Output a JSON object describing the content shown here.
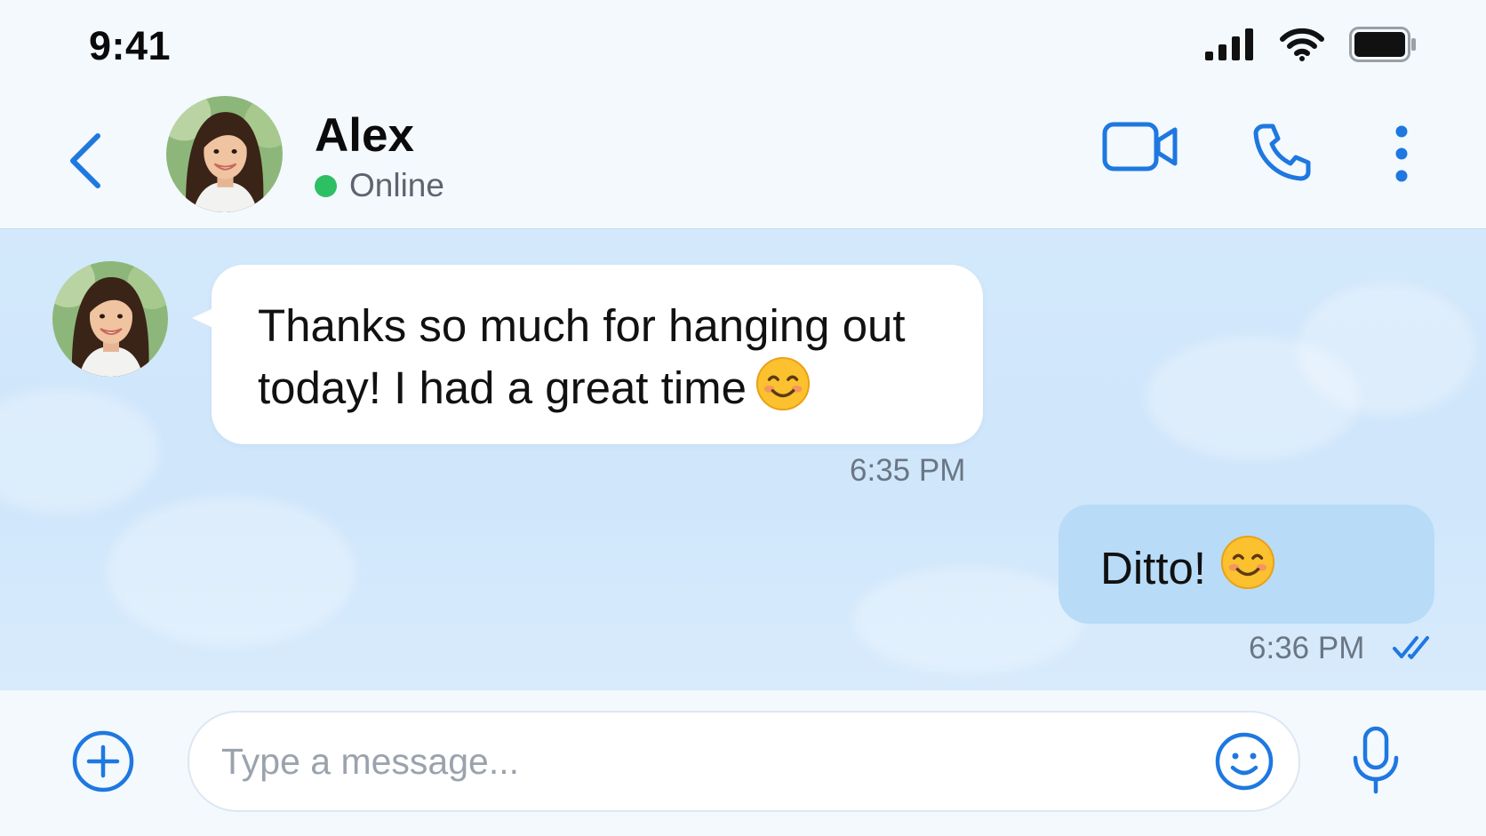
{
  "status_bar": {
    "time": "9:41",
    "icons": [
      "cellular-signal-icon",
      "wifi-icon",
      "battery-icon"
    ]
  },
  "header": {
    "back_icon": "chevron-left-icon",
    "contact_name": "Alex",
    "presence": "Online",
    "presence_color": "#2dbf63",
    "actions": [
      "video-call-icon",
      "phone-call-icon",
      "more-vertical-icon"
    ]
  },
  "messages": [
    {
      "direction": "incoming",
      "text": "Thanks so much for hanging out today! I had a great time",
      "emoji": "smiling-face-icon",
      "time": "6:35 PM"
    },
    {
      "direction": "outgoing",
      "text": "Ditto!",
      "emoji": "smiling-face-icon",
      "time": "6:36 PM",
      "status_icon": "double-check-read-icon"
    }
  ],
  "composer": {
    "placeholder": "Type a message...",
    "value": "",
    "add_icon": "plus-circle-icon",
    "emoji_icon": "emoji-smile-icon",
    "mic_icon": "microphone-icon"
  },
  "colors": {
    "accent": "#1e78e0",
    "chat_background": "#d3e8fb",
    "incoming_bubble": "#ffffff",
    "outgoing_bubble": "#b8dbf7"
  }
}
